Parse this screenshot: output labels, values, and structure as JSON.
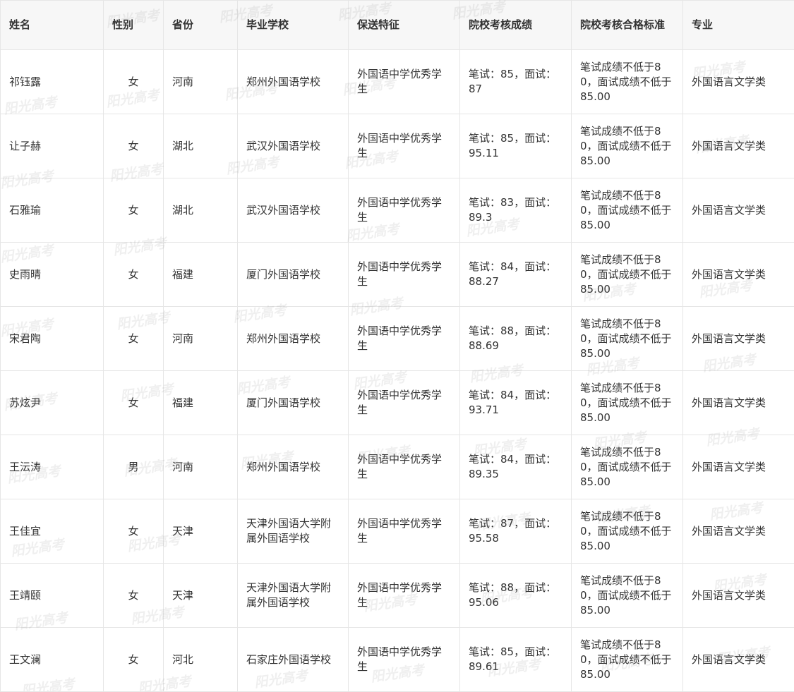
{
  "table": {
    "headers": [
      "姓名",
      "性别",
      "省份",
      "毕业学校",
      "保送特征",
      "院校考核成绩",
      "院校考核合格标准",
      "专业"
    ],
    "rows": [
      [
        "祁钰露",
        "女",
        "河南",
        "郑州外国语学校",
        "外国语中学优秀学生",
        "笔试：85，面试：87",
        "笔试成绩不低于80，面试成绩不低于85.00",
        "外国语言文学类"
      ],
      [
        "让子赫",
        "女",
        "湖北",
        "武汉外国语学校",
        "外国语中学优秀学生",
        "笔试：85，面试：95.11",
        "笔试成绩不低于80，面试成绩不低于85.00",
        "外国语言文学类"
      ],
      [
        "石雅瑜",
        "女",
        "湖北",
        "武汉外国语学校",
        "外国语中学优秀学生",
        "笔试：83，面试：89.3",
        "笔试成绩不低于80，面试成绩不低于85.00",
        "外国语言文学类"
      ],
      [
        "史雨晴",
        "女",
        "福建",
        "厦门外国语学校",
        "外国语中学优秀学生",
        "笔试：84，面试：88.27",
        "笔试成绩不低于80，面试成绩不低于85.00",
        "外国语言文学类"
      ],
      [
        "宋君陶",
        "女",
        "河南",
        "郑州外国语学校",
        "外国语中学优秀学生",
        "笔试：88，面试：88.69",
        "笔试成绩不低于80，面试成绩不低于85.00",
        "外国语言文学类"
      ],
      [
        "苏炫尹",
        "女",
        "福建",
        "厦门外国语学校",
        "外国语中学优秀学生",
        "笔试：84，面试：93.71",
        "笔试成绩不低于80，面试成绩不低于85.00",
        "外国语言文学类"
      ],
      [
        "王沄涛",
        "男",
        "河南",
        "郑州外国语学校",
        "外国语中学优秀学生",
        "笔试：84，面试：89.35",
        "笔试成绩不低于80，面试成绩不低于85.00",
        "外国语言文学类"
      ],
      [
        "王佳宜",
        "女",
        "天津",
        "天津外国语大学附属外国语学校",
        "外国语中学优秀学生",
        "笔试：87，面试：95.58",
        "笔试成绩不低于80，面试成绩不低于85.00",
        "外国语言文学类"
      ],
      [
        "王靖颐",
        "女",
        "天津",
        "天津外国语大学附属外国语学校",
        "外国语中学优秀学生",
        "笔试：88，面试：95.06",
        "笔试成绩不低于80，面试成绩不低于85.00",
        "外国语言文学类"
      ],
      [
        "王文澜",
        "女",
        "河北",
        "石家庄外国语学校",
        "外国语中学优秀学生",
        "笔试：85，面试：89.61",
        "笔试成绩不低于80，面试成绩不低于85.00",
        "外国语言文学类"
      ]
    ]
  },
  "watermark": {
    "text": "阳光高考"
  }
}
